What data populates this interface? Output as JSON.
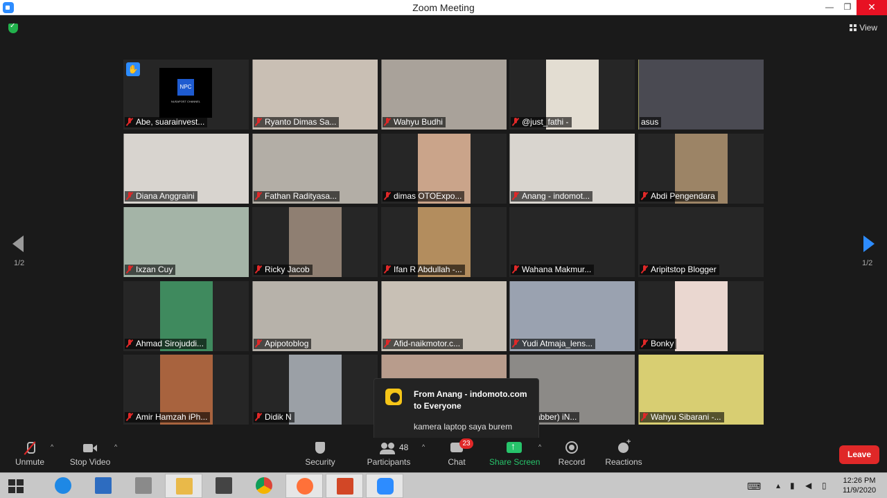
{
  "window": {
    "title": "Zoom Meeting",
    "min_glyph": "—",
    "max_glyph": "❐",
    "close_glyph": "✕"
  },
  "meeting": {
    "view_label": "View",
    "page_indicator": "1/2"
  },
  "participants": [
    {
      "name": "Abe, suarainvest...",
      "bg": "#262626",
      "video": null,
      "hand_raised": true,
      "active": false
    },
    {
      "name": "Ryanto Dimas Sa...",
      "bg": "#262626",
      "video": "#c9bfb4",
      "active": false
    },
    {
      "name": "Wahyu Budhi",
      "bg": "#262626",
      "video": "#a9a29a",
      "active": false
    },
    {
      "name": "@just_fathi -",
      "bg": "#262626",
      "video": "#e3ddd2",
      "narrow": true,
      "active": false
    },
    {
      "name": "asus",
      "bg": "#262626",
      "video": "#4a4a52",
      "active": true
    },
    {
      "name": "Diana Anggraini",
      "bg": "#262626",
      "video": "#d8d4cf",
      "active": false
    },
    {
      "name": "Fathan Radityasa...",
      "bg": "#262626",
      "video": "#b3aea6",
      "active": false
    },
    {
      "name": "dimas OTOExpo...",
      "bg": "#262626",
      "video": "#caa48a",
      "narrow": true,
      "active": false
    },
    {
      "name": "Anang - indomot...",
      "bg": "#262626",
      "video": "#d9d5cf",
      "active": false
    },
    {
      "name": "Abdi Pengendara",
      "bg": "#262626",
      "video": "#9c8466",
      "narrow": true,
      "active": false
    },
    {
      "name": "Ixzan Cuy",
      "bg": "#262626",
      "video": "#a4b4a7",
      "active": false
    },
    {
      "name": "Ricky Jacob",
      "bg": "#262626",
      "video": "#8f7f72",
      "narrow": true,
      "active": false
    },
    {
      "name": "Ifan R Abdullah -...",
      "bg": "#262626",
      "video": "#b38d5e",
      "narrow": true,
      "active": false
    },
    {
      "name": "Wahana Makmur...",
      "bg": "#262626",
      "video": null,
      "active": false
    },
    {
      "name": "Aripitstop Blogger",
      "bg": "#262626",
      "video": null,
      "active": false
    },
    {
      "name": "Ahmad Sirojuddi...",
      "bg": "#262626",
      "video": "#3f8a5e",
      "narrow": true,
      "active": false
    },
    {
      "name": "Apipotoblog",
      "bg": "#262626",
      "video": "#b7b2aa",
      "active": false
    },
    {
      "name": "Afid-naikmotor.c...",
      "bg": "#262626",
      "video": "#c8c0b5",
      "active": false
    },
    {
      "name": "Yudi Atmaja_lens...",
      "bg": "#262626",
      "video": "#9aa2b0",
      "active": false
    },
    {
      "name": "Bonky",
      "bg": "#262626",
      "video": "#ead7d0",
      "narrow": true,
      "active": false
    },
    {
      "name": "Amir Hamzah iPh...",
      "bg": "#262626",
      "video": "#a8633e",
      "narrow": true,
      "active": false
    },
    {
      "name": "Didik N",
      "bg": "#262626",
      "video": "#9ba0a6",
      "narrow": true,
      "active": false
    },
    {
      "name": "",
      "bg": "#262626",
      "video": "#b89c8c",
      "active": false
    },
    {
      "name": "n (Jabber) iN...",
      "bg": "#262626",
      "video": "#8c8a87",
      "active": false
    },
    {
      "name": "Wahyu Sibarani -...",
      "bg": "#262626",
      "video": "#d8ce72",
      "active": false
    }
  ],
  "npc": {
    "logo_text": "NPC",
    "channel_text": "NUSAPOST CHANNEL"
  },
  "chat_popup": {
    "from": "From Anang - indomoto.com to Everyone",
    "message": "kamera laptop saya burem"
  },
  "controls": {
    "unmute": "Unmute",
    "stop_video": "Stop Video",
    "security": "Security",
    "participants": "Participants",
    "participants_count": "48",
    "chat": "Chat",
    "chat_badge": "23",
    "share_screen": "Share Screen",
    "record": "Record",
    "reactions": "Reactions",
    "leave": "Leave",
    "caret": "^"
  },
  "taskbar": {
    "time": "12:26 PM",
    "date": "11/9/2020"
  },
  "colors": {
    "accent_blue": "#2d8cff",
    "leave_red": "#e02828",
    "share_green": "#27c46b",
    "active_speaker": "#e8e45a"
  }
}
